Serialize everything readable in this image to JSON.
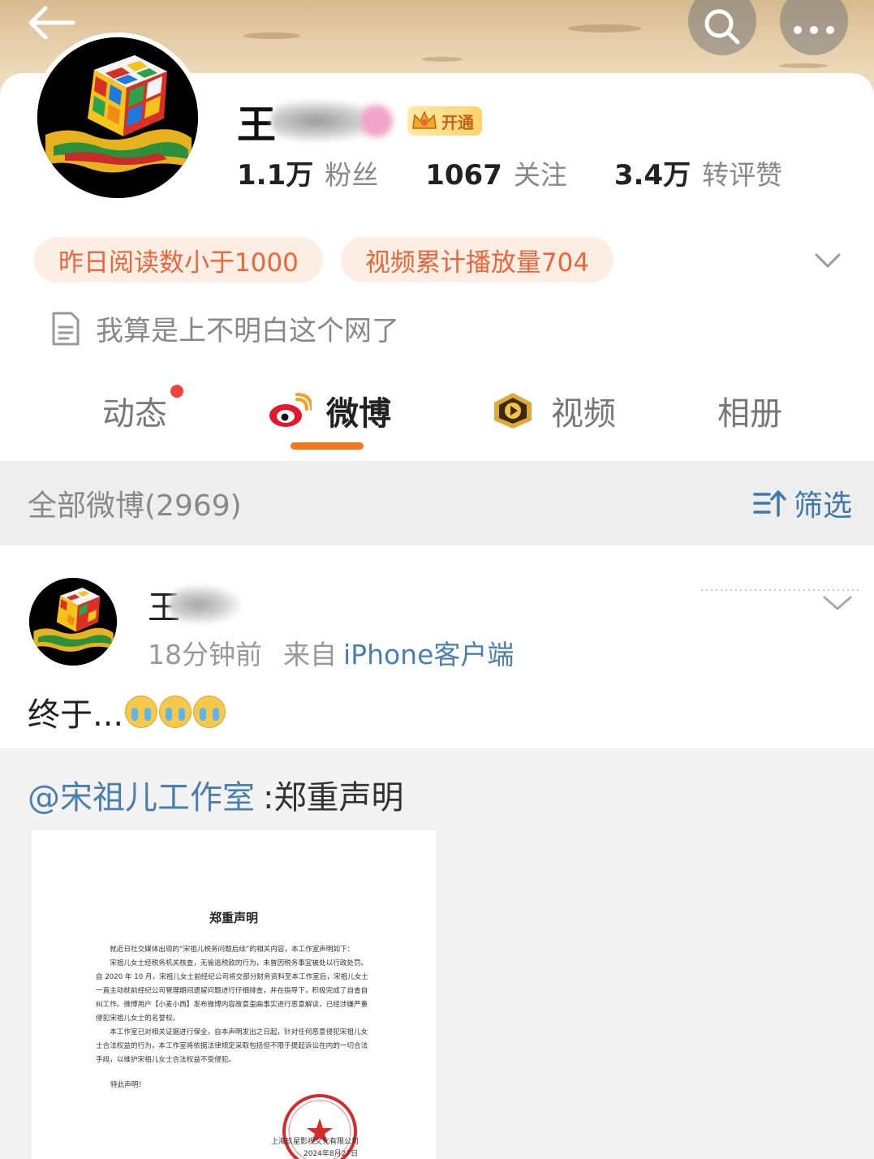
{
  "header": {
    "back_icon": "arrow-left-icon",
    "search_icon": "search-icon",
    "more_icon": "more-dots-icon"
  },
  "profile": {
    "name_visible": "王",
    "vip_badge": "开通",
    "stats": [
      {
        "num": "1.1万",
        "label": "粉丝"
      },
      {
        "num": "1067",
        "label": "关注"
      },
      {
        "num": "3.4万",
        "label": "转评赞"
      }
    ],
    "chips": [
      "昨日阅读数小于1000",
      "视频累计播放量704"
    ],
    "bio": "我算是上不明白这个网了"
  },
  "tabs": [
    {
      "label": "动态",
      "has_dot": true
    },
    {
      "label": "微博",
      "active": true
    },
    {
      "label": "视频"
    },
    {
      "label": "相册"
    }
  ],
  "filter": {
    "count_label": "全部微博(2969)",
    "filter_label": "筛选"
  },
  "post": {
    "author_visible": "王",
    "time": "18分钟前",
    "from_label": "来自",
    "source": "iPhone客户端",
    "text": "终于...",
    "emoji_count": 3,
    "repost": {
      "mention": "@宋祖儿工作室",
      "text": ":郑重声明",
      "doc": {
        "title": "郑重声明",
        "lines": [
          "就近日社交媒体出现的“宋祖儿税务问题后续”的相关内容，本工作室声明如下：",
          "宋祖儿女士经税务机关核查，无偷逃税款的行为，未曾因税务事宜被处以行政处罚。自 2020 年 10 月，宋祖儿女士前经纪公司将交部分财务资料至本工作室后，宋祖儿女士一直主动就前经纪公司管理期间遗留问题进行仔细排查，并在指导下，积极完成了自查自纠工作。微博用户【小麦小西】发布微博内容故意歪曲事实进行恶意解读，已经涉嫌严重侵犯宋祖儿女士的名誉权。",
          "本工作室已对相关证据进行保全，自本声明发出之日起，针对任何恶意侵犯宋祖儿女士合法权益的行为，本工作室将依据法律规定采取包括但不限于提起诉讼在内的一切合法手段，以维护宋祖儿女士合法权益不受侵犯。"
        ],
        "closing": "特此声明！",
        "signature": "上海玖星影视文化有限公司",
        "date": "2024年8月27日"
      }
    }
  },
  "colors": {
    "accent_orange": "#f6761f",
    "link_blue": "#4a7fb0",
    "chip_bg": "#fdeee4",
    "chip_text": "#e8663c"
  }
}
